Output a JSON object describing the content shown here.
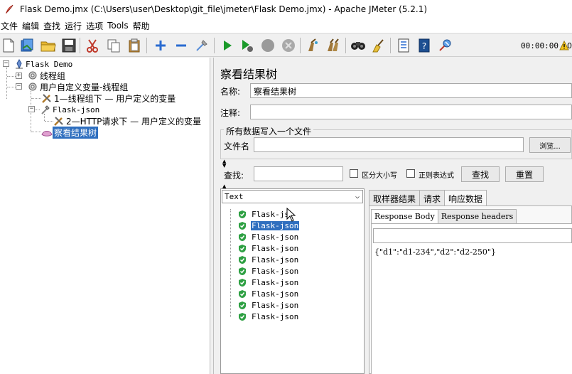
{
  "window": {
    "title": "Flask Demo.jmx (C:\\Users\\user\\Desktop\\git_file\\jmeter\\Flask Demo.jmx) - Apache JMeter (5.2.1)"
  },
  "menu": [
    "文件",
    "编辑",
    "查找",
    "运行",
    "选项",
    "Tools",
    "帮助"
  ],
  "toolbar": {
    "timer": "00:00:00",
    "icons": [
      "new-icon",
      "templates-icon",
      "open-icon",
      "save-icon",
      "cut-icon",
      "copy-icon",
      "paste-icon",
      "expand-icon",
      "collapse-icon",
      "toggle-icon",
      "start-icon",
      "start-no-pause-icon",
      "stop-icon",
      "shutdown-icon",
      "clear-icon",
      "clear-all-icon",
      "search-icon",
      "reset-search-icon",
      "function-helper-icon",
      "help-icon",
      "remote-icon",
      "warning-icon",
      "log-count"
    ],
    "warning": "⚠",
    "log_count": "0"
  },
  "tree": {
    "root": "Flask Demo",
    "thread_group": "线程组",
    "user_defined_group": "用户自定义变量-线程组",
    "udv_1": "1—线程组下 — 用户定义的变量",
    "http_sampler": "Flask-json",
    "udv_2": "2—HTTP请求下 — 用户定义的变量",
    "listener": "察看结果树"
  },
  "panel": {
    "title": "察看结果树",
    "name_label": "名称:",
    "name_value": "察看结果树",
    "comment_label": "注释:",
    "comment_value": "",
    "file_group": "所有数据写入一个文件",
    "file_label": "文件名",
    "browse_button": "浏览...",
    "search_label": "查找:",
    "case_sensitive": "区分大小写",
    "regex": "正则表达式",
    "search_button": "查找",
    "reset_button": "重置"
  },
  "results": {
    "renderer": "Text",
    "samples": [
      "Flask-json",
      "Flask-json",
      "Flask-json",
      "Flask-json",
      "Flask-json",
      "Flask-json",
      "Flask-json",
      "Flask-json",
      "Flask-json",
      "Flask-json"
    ],
    "first_sample_visible": "Flask-js",
    "tabs": [
      "取样器结果",
      "请求",
      "响应数据"
    ],
    "subtabs": [
      "Response Body",
      "Response headers"
    ],
    "response_body": "{\"d1\":\"d1-234\",\"d2\":\"d2-250\"}"
  },
  "colors": {
    "selection": "#2f6fbf",
    "success": "#2ea043",
    "start": "#1a9a2a"
  }
}
